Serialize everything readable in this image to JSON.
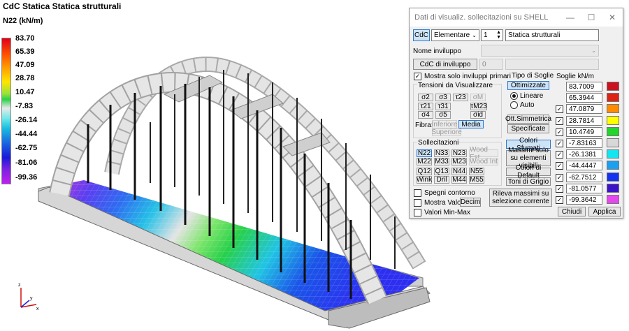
{
  "viewport": {
    "title": "CdC Statica Statica strutturali",
    "subtitle": "N22 (kN/m)",
    "legend": [
      "83.70",
      "65.39",
      "47.09",
      "28.78",
      "10.47",
      "-7.83",
      "-26.14",
      "-44.44",
      "-62.75",
      "-81.06",
      "-99.36"
    ],
    "axes": {
      "x": "x",
      "y": "y",
      "z": "z"
    }
  },
  "dialog": {
    "title": "Dati di visualiz. sollecitazioni su SHELL",
    "cdc_button": "CdC",
    "cdc_type": "Elementare",
    "cdc_number": "1",
    "cdc_name": "Statica strutturali",
    "envelope_name_label": "Nome inviluppo",
    "envelope_cdc_button": "CdC di inviluppo",
    "envelope_number": "0",
    "only_primary_label": "Mostra solo inviluppi primari",
    "only_primary_checked": true,
    "tensions_label": "Tensioni da Visualizzare",
    "tensions": [
      "σ2",
      "σ3",
      "τ23",
      "σM",
      "τ21",
      "τ31",
      "τM23",
      "σ4",
      "σ5",
      "σid"
    ],
    "fibra_label": "Fibra:",
    "fibra_options": [
      "Inferiore",
      "Media",
      "Superiore"
    ],
    "soglie_type_label": "Tipo di Soglie",
    "ottimizzate_button": "Ottimizzate",
    "lineare_label": "Lineare",
    "auto_label": "Auto",
    "ott_simmetrica_button": "Ott.Simmetrica",
    "specificate_button": "Specificate",
    "sollecitazioni_label": "Sollecitazioni",
    "sollecitazioni": [
      "N22",
      "N33",
      "N23",
      "Wood Est",
      "M22",
      "M33",
      "M23",
      "Wood Int",
      "Q12",
      "Q13",
      "N44",
      "N55",
      "Wink",
      "Dril",
      "M44",
      "M55"
    ],
    "colori_sfumati_button": "Colori Sfumati",
    "massimi_button": "Massimi solo su elementi visibili",
    "colori_default_button": "Colori di Default",
    "toni_grigio_button": "Toni di Grigio",
    "spegni_contorno_label": "Spegni contorno",
    "mostra_valori_label": "Mostra Valori",
    "decim_button": "Decim",
    "valori_minmax_label": "Valori Min-Max",
    "rileva_button": "Rileva massimi su selezione corrente",
    "soglie_label": "Soglie kN/m",
    "soglie": [
      {
        "value": "83.7009",
        "color": "#c8141e",
        "check": false
      },
      {
        "value": "65.3944",
        "color": "#dc2314",
        "check": false
      },
      {
        "value": "47.0879",
        "color": "#ff8c00",
        "check": true
      },
      {
        "value": "28.7814",
        "color": "#ffff00",
        "check": true
      },
      {
        "value": "10.4749",
        "color": "#22d62b",
        "check": true
      },
      {
        "value": "-7.83163",
        "color": "#d8d8d8",
        "check": true
      },
      {
        "value": "-26.1381",
        "color": "#13e6f0",
        "check": true
      },
      {
        "value": "-44.4447",
        "color": "#1aa0f0",
        "check": true
      },
      {
        "value": "-62.7512",
        "color": "#1432f0",
        "check": true
      },
      {
        "value": "-81.0577",
        "color": "#3c14c8",
        "check": true
      },
      {
        "value": "-99.3642",
        "color": "#e646f0",
        "check": true
      }
    ],
    "chiudi_button": "Chiudi",
    "applica_button": "Applica"
  }
}
